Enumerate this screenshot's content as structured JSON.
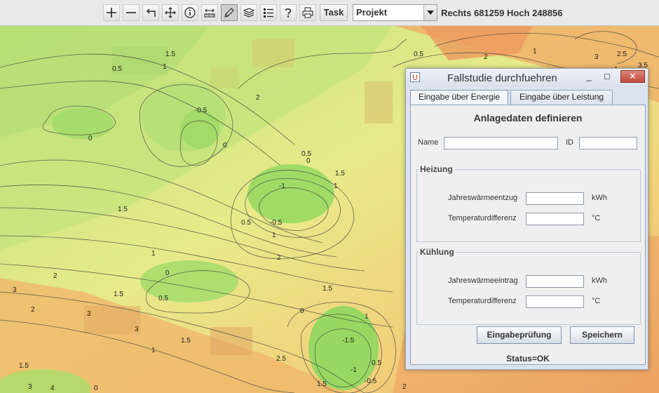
{
  "toolbar": {
    "tools": [
      {
        "name": "zoom-in-icon"
      },
      {
        "name": "zoom-out-icon"
      },
      {
        "name": "back-icon"
      },
      {
        "name": "pan-icon"
      },
      {
        "name": "info-icon"
      },
      {
        "name": "measure-icon"
      },
      {
        "name": "pencil-icon"
      },
      {
        "name": "layers-icon"
      },
      {
        "name": "legend-icon"
      },
      {
        "name": "help-icon"
      },
      {
        "name": "print-icon"
      }
    ],
    "task_label": "Task",
    "project_value": "Projekt",
    "coordinates": "Rechts 681259 Hoch 248856"
  },
  "map": {
    "contour_labels": [
      "1.5",
      "0.5",
      "1",
      "0.5",
      "2",
      "2",
      "1",
      "3",
      "4",
      "2.5",
      "3.5",
      "-0.5",
      "0",
      "0",
      "0.5",
      "0",
      "1",
      "1.5",
      "-1",
      "1",
      "1.5",
      "0.5",
      "-0.5",
      "1",
      "0",
      "2",
      "0.5",
      "1.5",
      "1.5",
      "1",
      "3",
      "2",
      "3",
      "2",
      "3",
      "1",
      "0",
      "1.5",
      "-1.5",
      "-1",
      "-0.5",
      "2.5",
      "1.5",
      "0.5",
      "1.5",
      "0",
      "4",
      "3",
      "2"
    ]
  },
  "dialog": {
    "title": "Fallstudie durchfuehren",
    "minimize_symbol": "_",
    "maximize_symbol": "□",
    "close_symbol": "✕",
    "tabs": [
      {
        "label": "Eingabe über Energie",
        "active": true
      },
      {
        "label": "Eingabe über Leistung",
        "active": false
      }
    ],
    "heading": "Anlagedaten definieren",
    "name_label": "Name",
    "name_value": "",
    "id_label": "ID",
    "id_value": "",
    "heizung": {
      "title": "Heizung",
      "row1_label": "Jahreswärmeentzug",
      "row1_value": "",
      "row1_unit": "kWh",
      "row2_label": "Temperaturdifferenz",
      "row2_value": "",
      "row2_unit": "°C"
    },
    "kuehlung": {
      "title": "Kühlung",
      "row1_label": "Jahreswärmeeintrag",
      "row1_value": "",
      "row1_unit": "kWh",
      "row2_label": "Temperaturdifferenz",
      "row2_value": "",
      "row2_unit": "°C"
    },
    "check_button": "Eingabeprüfung",
    "save_button": "Speichern",
    "status": "Status=OK"
  },
  "colors": {
    "map_green": "#a8dd6a",
    "map_yellow": "#f0ea8a",
    "map_orange": "#eeb066",
    "dialog_bg": "#dbe3ee",
    "close_button": "#c4493a"
  }
}
